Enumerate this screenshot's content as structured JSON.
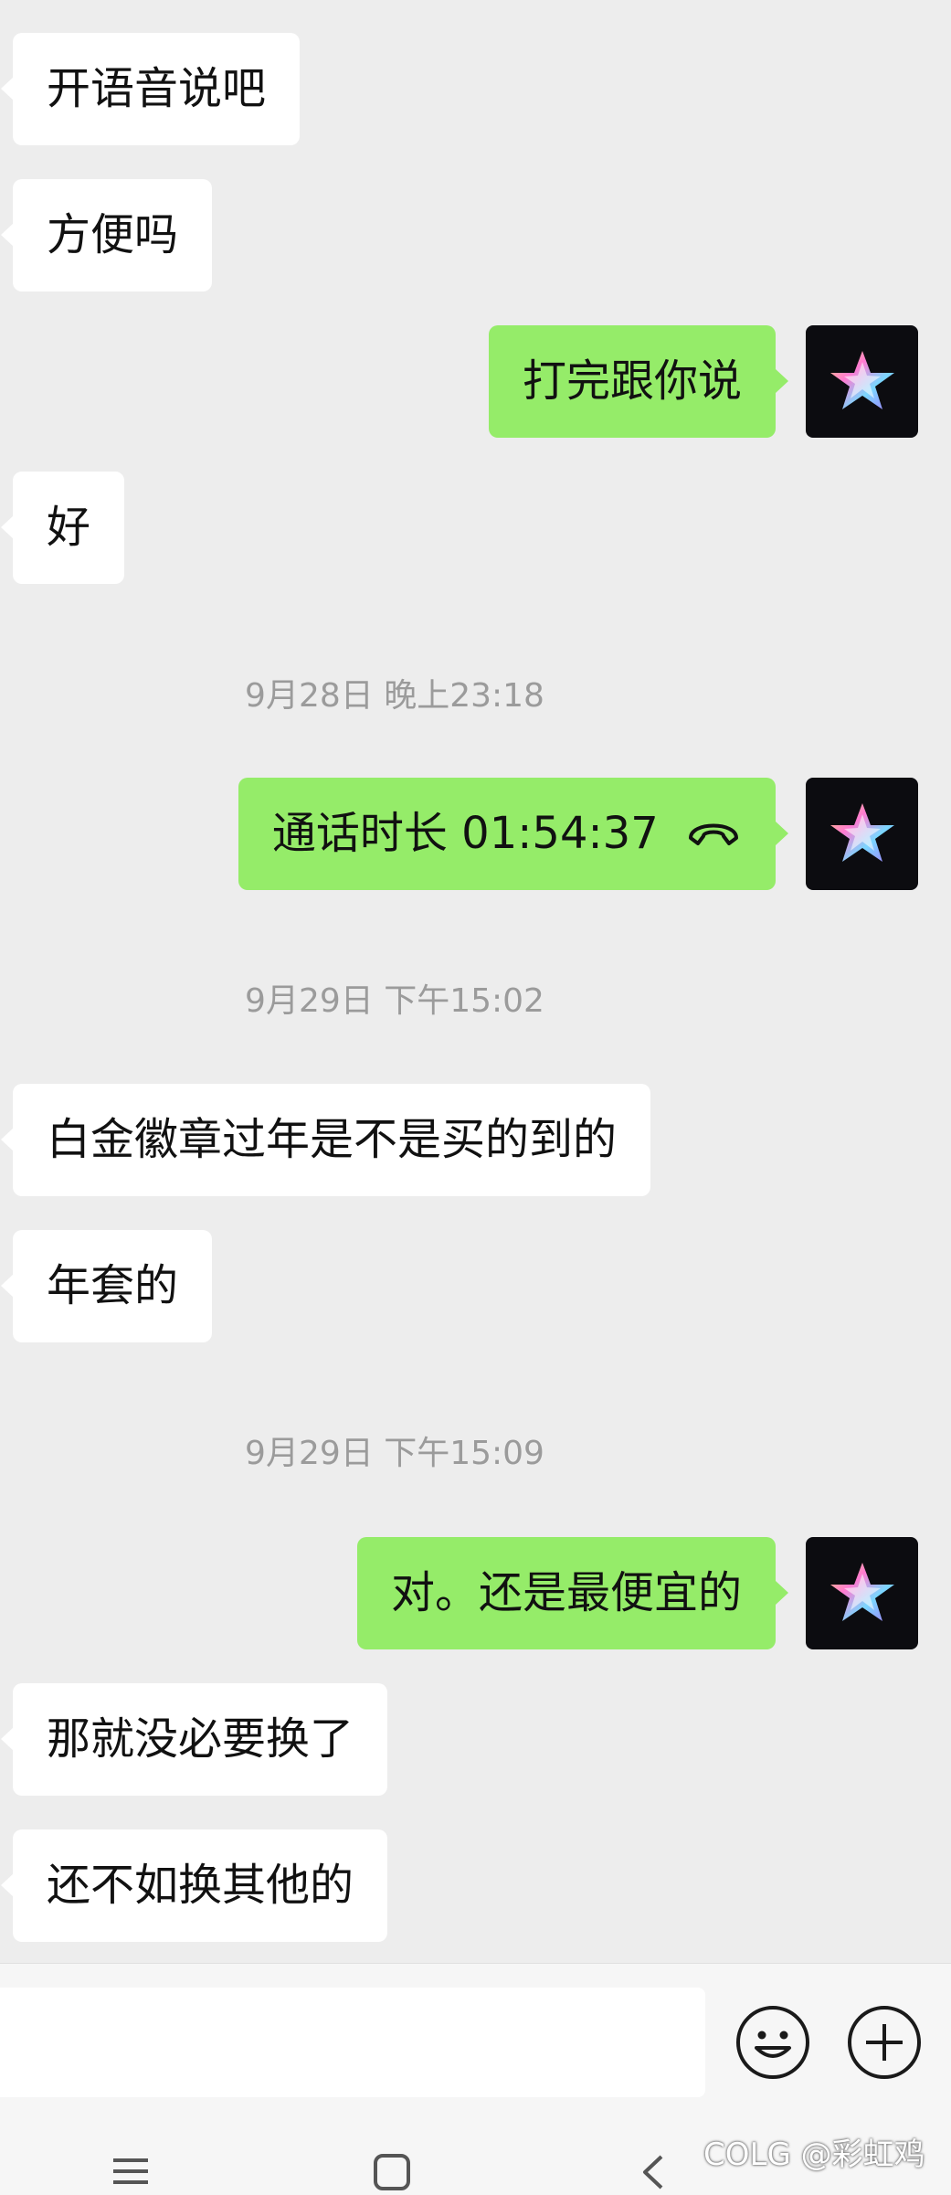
{
  "messages": [
    {
      "side": "in",
      "text": "开语音说吧"
    },
    {
      "side": "in",
      "text": "方便吗"
    },
    {
      "side": "out",
      "text": "打完跟你说"
    },
    {
      "side": "in",
      "text": "好"
    },
    {
      "timestamp": "9月28日 晚上23:18"
    },
    {
      "side": "out",
      "type": "call",
      "text": "通话时长 01:54:37"
    },
    {
      "timestamp": "9月29日 下午15:02"
    },
    {
      "side": "in",
      "text": "白金徽章过年是不是买的到的"
    },
    {
      "side": "in",
      "text": "年套的"
    },
    {
      "timestamp": "9月29日 下午15:09"
    },
    {
      "side": "out",
      "text": "对。还是最便宜的"
    },
    {
      "side": "in",
      "text": "那就没必要换了"
    },
    {
      "side": "in",
      "text": "还不如换其他的"
    }
  ],
  "input_bar": {
    "text_value": "",
    "emoji_icon": "emoji-smile-icon",
    "plus_icon": "plus-circle-icon"
  },
  "system_nav": {
    "menu_icon": "menu-icon",
    "home_icon": "home-square-icon",
    "back_icon": "back-chevron-icon"
  },
  "watermark": "COLG @彩虹鸡",
  "colors": {
    "background": "#ededed",
    "incoming_bubble": "#ffffff",
    "outgoing_bubble": "#95ec69",
    "timestamp_text": "#9b9b9b",
    "avatar_bg": "#0c0c10"
  }
}
